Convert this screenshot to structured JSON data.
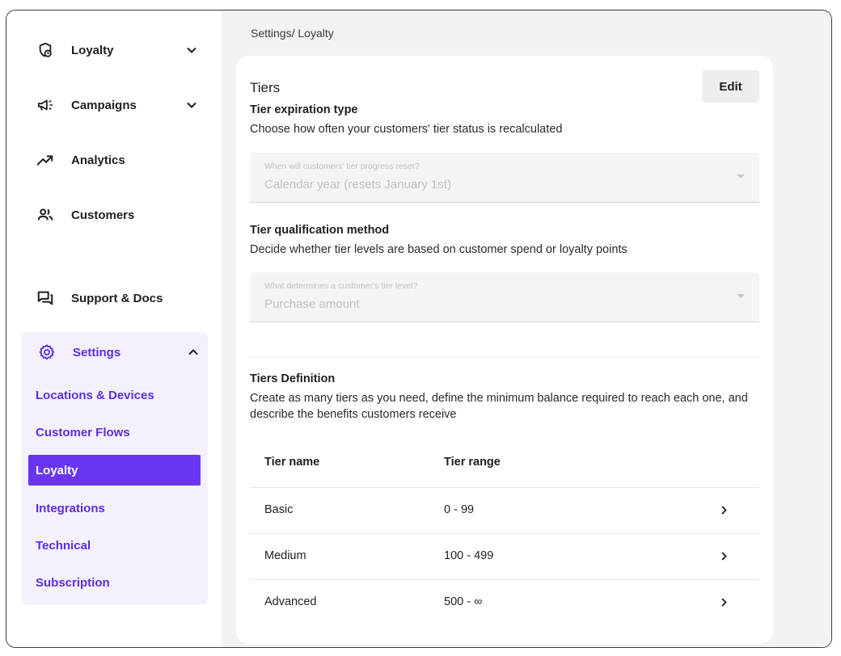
{
  "sidebar": {
    "nav": [
      {
        "label": "Loyalty",
        "icon": "loyalty-shield-icon",
        "expandable": true
      },
      {
        "label": "Campaigns",
        "icon": "megaphone-icon",
        "expandable": true
      },
      {
        "label": "Analytics",
        "icon": "trending-up-icon",
        "expandable": false
      },
      {
        "label": "Customers",
        "icon": "people-icon",
        "expandable": false
      }
    ],
    "support": {
      "label": "Support & Docs",
      "icon": "chat-bubbles-icon"
    },
    "settings": {
      "label": "Settings",
      "icon": "gear-icon",
      "expanded": true,
      "items": [
        {
          "label": "Locations & Devices"
        },
        {
          "label": "Customer Flows"
        },
        {
          "label": "Loyalty",
          "active": true
        },
        {
          "label": "Integrations"
        },
        {
          "label": "Technical"
        },
        {
          "label": "Subscription"
        }
      ]
    },
    "accent_color": "#5b2ee6",
    "active_color": "#6a35f0"
  },
  "breadcrumb": "Settings/ Loyalty",
  "card": {
    "title": "Tiers",
    "edit_label": "Edit",
    "expiration": {
      "title": "Tier expiration type",
      "description": "Choose how often your customers' tier status is recalculated",
      "select_label": "When will customers' tier progress reset?",
      "select_value": "Calendar year (resets January 1st)"
    },
    "qualification": {
      "title": "Tier qualification method",
      "description": "Decide whether tier levels are based on customer spend or loyalty points",
      "select_label": "What determines a customer's tier level?",
      "select_value": "Purchase amount"
    },
    "definition": {
      "title": "Tiers Definition",
      "description": "Create as many tiers as you need, define the minimum balance required to reach each one, and describe the benefits customers receive"
    },
    "table": {
      "headers": [
        "Tier name",
        "Tier range"
      ],
      "rows": [
        {
          "name": "Basic",
          "range": "0 - 99"
        },
        {
          "name": "Medium",
          "range": "100 - 499"
        },
        {
          "name": "Advanced",
          "range": "500 - ∞"
        }
      ]
    }
  }
}
